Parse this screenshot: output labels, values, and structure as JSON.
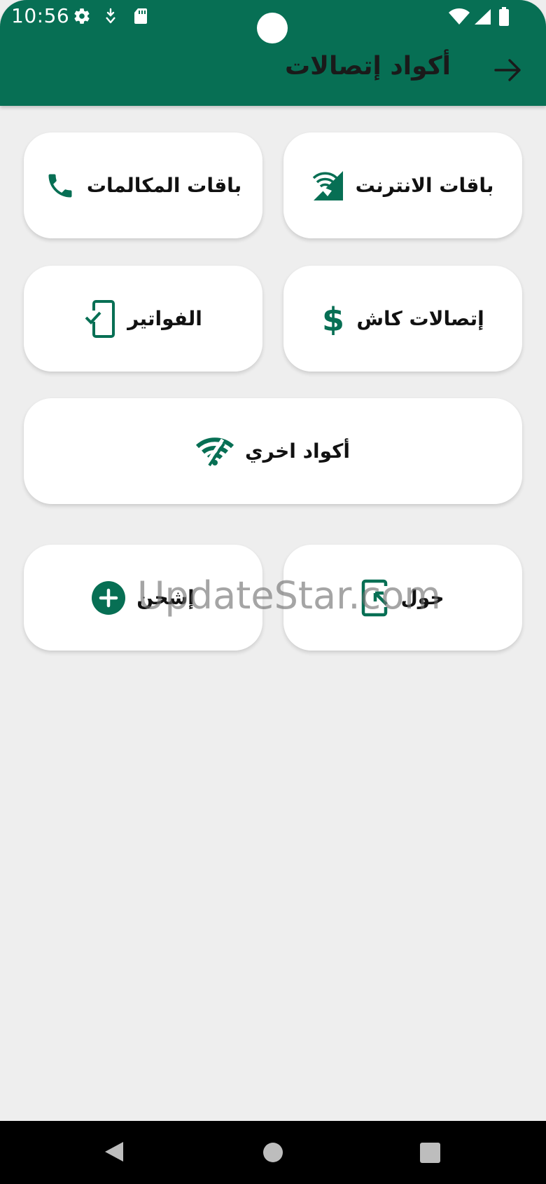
{
  "status_bar": {
    "time": "10:56",
    "left_icons": [
      "gear-icon",
      "download-arrow-icon",
      "sd-card-icon"
    ],
    "right_icons": [
      "wifi-icon",
      "signal-icon",
      "battery-icon"
    ]
  },
  "header": {
    "title": "أكواد إتصالات",
    "back_icon": "arrow-right-icon",
    "background": "#076f54"
  },
  "cards": [
    {
      "id": "internet",
      "label": "باقات الانترنت",
      "icon": "signal-wifi-icon"
    },
    {
      "id": "calls",
      "label": "باقات المكالمات",
      "icon": "phone-icon"
    },
    {
      "id": "cash",
      "label": "إتصالات كاش",
      "icon": "dollar-icon"
    },
    {
      "id": "bills",
      "label": "الفواتير",
      "icon": "phone-check-icon"
    },
    {
      "id": "other",
      "label": "أكواد اخري",
      "icon": "wifi-off-icon"
    },
    {
      "id": "about",
      "label": "حول",
      "icon": "phone-arrow-icon"
    },
    {
      "id": "recharge",
      "label": "إشحن",
      "icon": "add-circle-icon"
    }
  ],
  "watermark": "UpdateStar.com",
  "nav_bar": {
    "buttons": [
      "back-triangle-icon",
      "home-circle-icon",
      "recents-square-icon"
    ]
  },
  "colors": {
    "accent": "#076f54",
    "background": "#eeeeee",
    "card": "#ffffff"
  }
}
